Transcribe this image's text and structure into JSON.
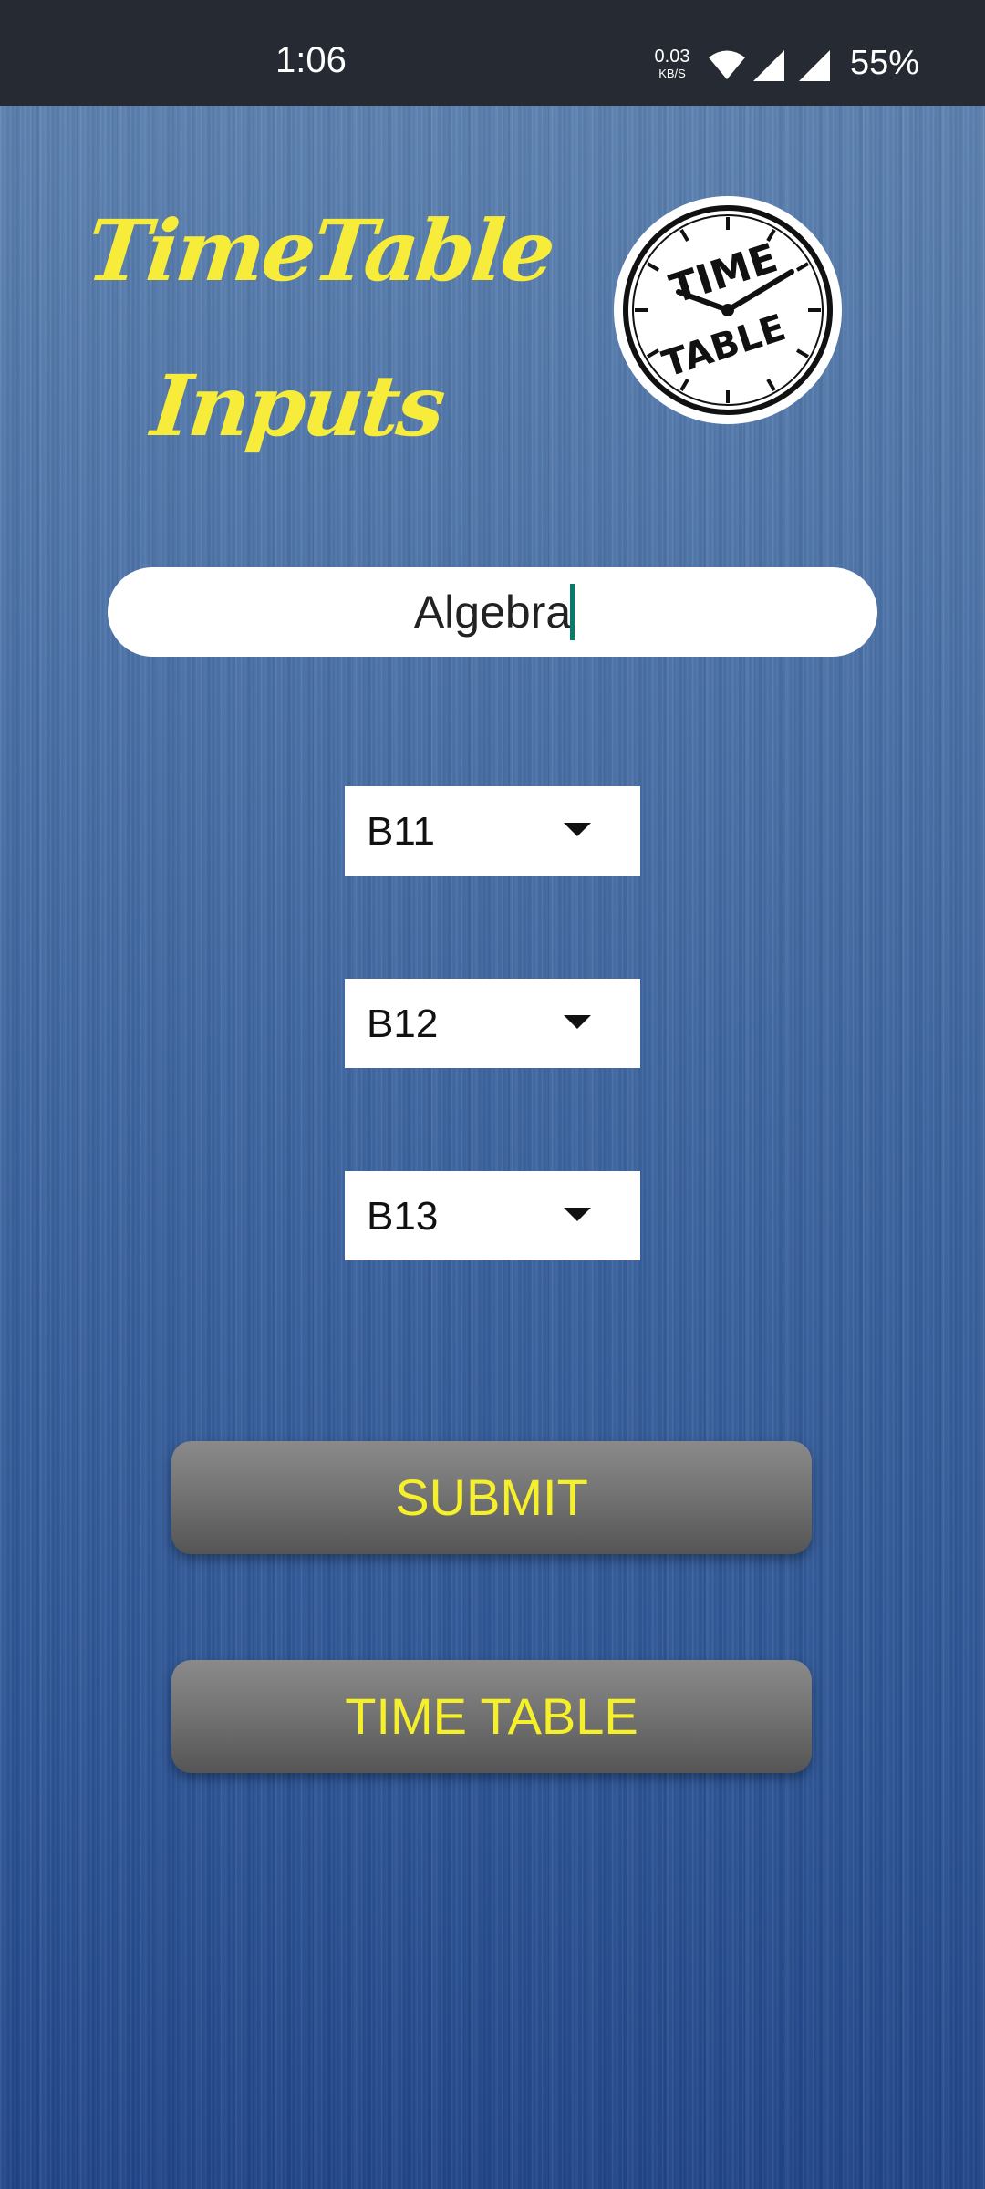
{
  "status_bar": {
    "time": "1:06",
    "net_speed_value": "0.03",
    "net_speed_unit": "KB/S",
    "battery": "55%",
    "icons": [
      "wifi-icon",
      "signal-icon",
      "signal-icon"
    ]
  },
  "header": {
    "title_line1": "TimeTable",
    "title_line2": "Inputs",
    "logo_text_top": "TIME",
    "logo_text_bottom": "TABLE"
  },
  "form": {
    "subject_value": "Algebra",
    "dropdowns": [
      {
        "selected": "B11"
      },
      {
        "selected": "B12"
      },
      {
        "selected": "B13"
      }
    ]
  },
  "buttons": {
    "submit_label": "SUBMIT",
    "timetable_label": "TIME TABLE"
  },
  "colors": {
    "accent_text": "#f7ec3a",
    "status_bar": "#262a33",
    "background": "#3f68a4",
    "caret": "#0c7a6a"
  }
}
